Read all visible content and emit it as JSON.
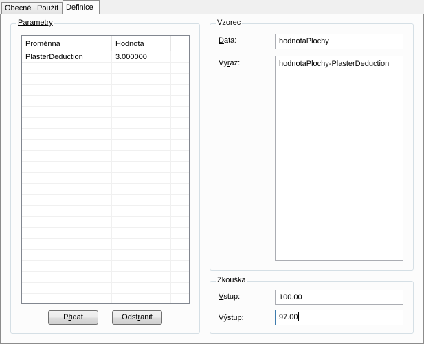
{
  "tabs": [
    {
      "label": "Obecné"
    },
    {
      "label": "Použít"
    },
    {
      "label": "Definice"
    }
  ],
  "parametry": {
    "title": "Parametry",
    "columns": [
      "Proměnná",
      "Hodnota"
    ],
    "rows": [
      {
        "name": "PlasterDeduction",
        "value": "3.000000"
      }
    ],
    "add_prefix": "P",
    "add_accel": "ř",
    "add_suffix": "idat",
    "remove_prefix": "Odst",
    "remove_accel": "r",
    "remove_suffix": "anit"
  },
  "vzorec": {
    "title": "Vzorec",
    "data_accel": "D",
    "data_rest": "ata:",
    "data_value": "hodnotaPlochy",
    "vyraz_prefix": "Vý",
    "vyraz_accel": "r",
    "vyraz_suffix": "az:",
    "vyraz_value": "hodnotaPlochy-PlasterDeduction"
  },
  "zkouska": {
    "title": "Zkouška",
    "vstup_accel": "V",
    "vstup_rest": "stup:",
    "vstup_value": "100.00",
    "vystup_prefix": "Vý",
    "vystup_accel": "s",
    "vystup_suffix": "tup:",
    "vystup_value": "97.00"
  }
}
